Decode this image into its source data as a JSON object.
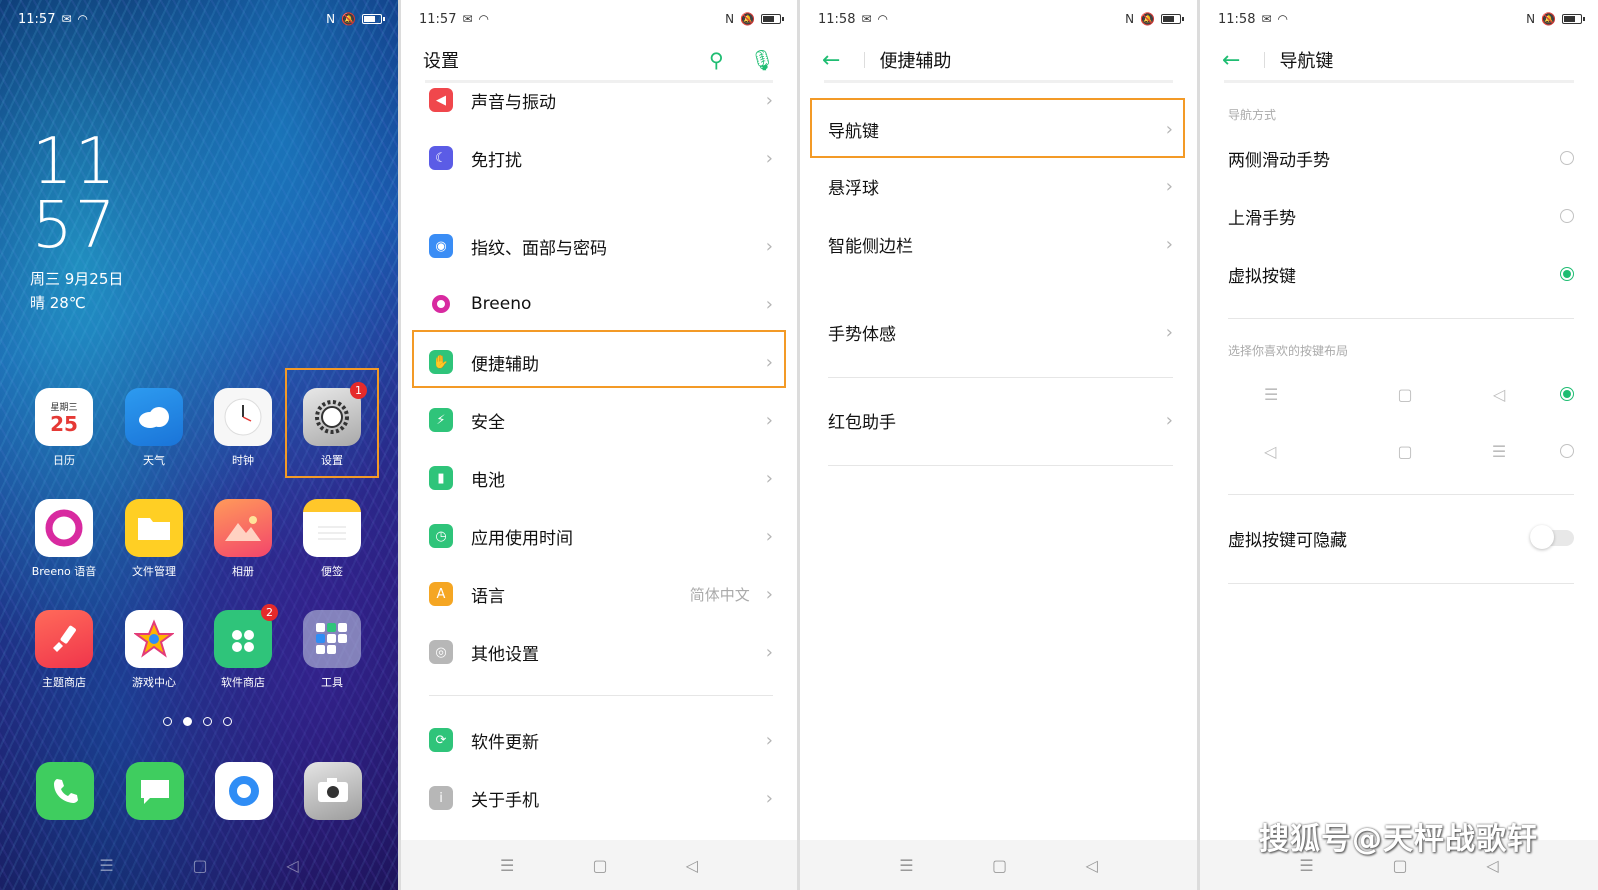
{
  "colors": {
    "accent": "#1fbd72",
    "highlight": "#f39a26",
    "badge": "#e52a2a"
  },
  "home": {
    "status": {
      "time": "11:57"
    },
    "clock": {
      "hour": "11",
      "minute": "57"
    },
    "date": "周三 9月25日",
    "weather": "晴 28℃",
    "apps": [
      {
        "label": "日历",
        "icon": "calendar-icon",
        "calendar_week": "星期三",
        "calendar_day": "25"
      },
      {
        "label": "天气",
        "icon": "cloud-icon"
      },
      {
        "label": "时钟",
        "icon": "clock-icon"
      },
      {
        "label": "设置",
        "icon": "gear-icon",
        "badge": "1"
      },
      {
        "label": "Breeno 语音",
        "icon": "breeno-icon"
      },
      {
        "label": "文件管理",
        "icon": "folder-icon"
      },
      {
        "label": "相册",
        "icon": "photos-icon"
      },
      {
        "label": "便签",
        "icon": "notes-icon"
      },
      {
        "label": "主题商店",
        "icon": "brush-icon"
      },
      {
        "label": "游戏中心",
        "icon": "star-icon"
      },
      {
        "label": "软件商店",
        "icon": "store-icon",
        "badge": "2"
      },
      {
        "label": "工具",
        "icon": "tools-folder-icon"
      }
    ],
    "dock": [
      "phone-icon",
      "messages-icon",
      "browser-icon",
      "camera-icon"
    ],
    "page_count": 4,
    "active_page": 2
  },
  "settings": {
    "status": {
      "time": "11:57"
    },
    "title": "设置",
    "items": [
      {
        "label": "声音与振动",
        "icon": "speaker-icon",
        "color": "#f0474c"
      },
      {
        "label": "免打扰",
        "icon": "moon-icon",
        "color": "#5b5ce6"
      },
      {
        "label": "指纹、面部与密码",
        "icon": "fingerprint-icon",
        "color": "#3a8df5"
      },
      {
        "label": "Breeno",
        "icon": "breeno-icon",
        "color": "#d82aa0"
      },
      {
        "label": "便捷辅助",
        "icon": "assist-icon",
        "color": "#2fc47a"
      },
      {
        "label": "安全",
        "icon": "shield-icon",
        "color": "#2fc47a"
      },
      {
        "label": "电池",
        "icon": "battery-icon",
        "color": "#2fc47a"
      },
      {
        "label": "应用使用时间",
        "icon": "timer-icon",
        "color": "#2fc47a"
      },
      {
        "label": "语言",
        "value": "简体中文",
        "icon": "language-icon",
        "color": "#f5a623"
      },
      {
        "label": "其他设置",
        "icon": "more-settings-icon",
        "color": "#b7b7b7"
      },
      {
        "label": "软件更新",
        "icon": "update-icon",
        "color": "#2fc47a"
      },
      {
        "label": "关于手机",
        "icon": "info-icon",
        "color": "#b7b7b7"
      }
    ]
  },
  "assist": {
    "status": {
      "time": "11:58"
    },
    "title": "便捷辅助",
    "items": [
      "导航键",
      "悬浮球",
      "智能侧边栏",
      "手势体感",
      "红包助手"
    ]
  },
  "nav": {
    "status": {
      "time": "11:58"
    },
    "title": "导航键",
    "method_label": "导航方式",
    "methods": [
      {
        "label": "两侧滑动手势",
        "selected": false
      },
      {
        "label": "上滑手势",
        "selected": false
      },
      {
        "label": "虚拟按键",
        "selected": true
      }
    ],
    "layout_label": "选择你喜欢的按键布局",
    "layouts": [
      {
        "keys": [
          "☰",
          "▢",
          "◁"
        ],
        "selected": true
      },
      {
        "keys": [
          "◁",
          "▢",
          "☰"
        ],
        "selected": false
      }
    ],
    "hide_label": "虚拟按键可隐藏",
    "hide_enabled": false
  },
  "navbar_keys": [
    "☰",
    "▢",
    "◁"
  ],
  "watermark": "搜狐号@天枰战歌轩"
}
